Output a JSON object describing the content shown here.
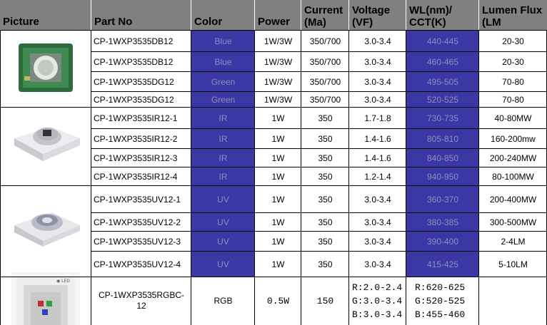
{
  "columns": {
    "picture": "Picture",
    "part_no": "Part No",
    "color": "Color",
    "power": "Power",
    "current": [
      "Current",
      "(Ma)"
    ],
    "voltage": [
      "Voltage",
      "(VF)"
    ],
    "wl": [
      "WL(nm)/",
      "CCT(K)"
    ],
    "lumen": [
      "Lumen Flux",
      "(LM"
    ]
  },
  "rows": [
    {
      "part": "CP-1WXP3535DB12",
      "color": "Blue",
      "power": "1W/3W",
      "current": "350/700",
      "voltage": "3.0-3.4",
      "wl": "440-445",
      "lumen": "20-30"
    },
    {
      "part": "CP-1WXP3535DB12",
      "color": "Blue",
      "power": "1W/3W",
      "current": "350/700",
      "voltage": "3.0-3.4",
      "wl": "460-465",
      "lumen": "20-30"
    },
    {
      "part": "CP-1WXP3535DG12",
      "color": "Green",
      "power": "1W/3W",
      "current": "350/700",
      "voltage": "3.0-3.4",
      "wl": "495-505",
      "lumen": "70-80"
    },
    {
      "part": "CP-1WXP3535DG12",
      "color": "Green",
      "power": "1W/3W",
      "current": "350/700",
      "voltage": "3.0-3.4",
      "wl": "520-525",
      "lumen": "70-80"
    },
    {
      "part": "CP-1WXP3535IR12-1",
      "color": "IR",
      "power": "1W",
      "current": "350",
      "voltage": "1.7-1.8",
      "wl": "730-735",
      "lumen": "40-80MW"
    },
    {
      "part": "CP-1WXP3535IR12-2",
      "color": "IR",
      "power": "1W",
      "current": "350",
      "voltage": "1.4-1.6",
      "wl": "805-810",
      "lumen": "160-200mw"
    },
    {
      "part": "CP-1WXP3535IR12-3",
      "color": "IR",
      "power": "1W",
      "current": "350",
      "voltage": "1.4-1.6",
      "wl": "840-850",
      "lumen": "200-240MW"
    },
    {
      "part": "CP-1WXP3535IR12-4",
      "color": "IR",
      "power": "1W",
      "current": "350",
      "voltage": "1.2-1.4",
      "wl": "940-950",
      "lumen": "80-100MW"
    },
    {
      "part": "CP-1WXP3535UV12-1",
      "color": "UV",
      "power": "1W",
      "current": "350",
      "voltage": "3.0-3.4",
      "wl": "360-370",
      "lumen": "200-400MW"
    },
    {
      "part": "CP-1WXP3535UV12-2",
      "color": "UV",
      "power": "1W",
      "current": "350",
      "voltage": "3.0-3.4",
      "wl": "380-385",
      "lumen": "300-500MW"
    },
    {
      "part": "CP-1WXP3535UV12-3",
      "color": "UV",
      "power": "1W",
      "current": "350",
      "voltage": "3.0-3.4",
      "wl": "390-400",
      "lumen": "2-4LM"
    },
    {
      "part": "CP-1WXP3535UV12-4",
      "color": "UV",
      "power": "1W",
      "current": "350",
      "voltage": "3.0-3.4",
      "wl": "415-425",
      "lumen": "5-10LM"
    }
  ],
  "rgb_row": {
    "part": [
      "CP-1WXP3535RGBC-",
      "12"
    ],
    "color": "RGB",
    "power": "0.5W",
    "current": "150",
    "voltage": [
      "R:2.0-2.4",
      "G:3.0-3.4",
      "B:3.0-3.4"
    ],
    "wl": [
      "R:620-625",
      "G:520-525",
      "B:455-460"
    ]
  },
  "colors": {
    "header_bg": "#808080",
    "highlight_blue": "#3b37a4",
    "pcb_green": "#2d6a3c",
    "ceramic": "#d9d9de"
  },
  "icons": {
    "picture_1": "green-pcb-led-icon",
    "picture_2": "ir-ceramic-led-icon",
    "picture_3": "uv-ceramic-led-icon",
    "picture_4": "rgb-led-package-icon"
  }
}
